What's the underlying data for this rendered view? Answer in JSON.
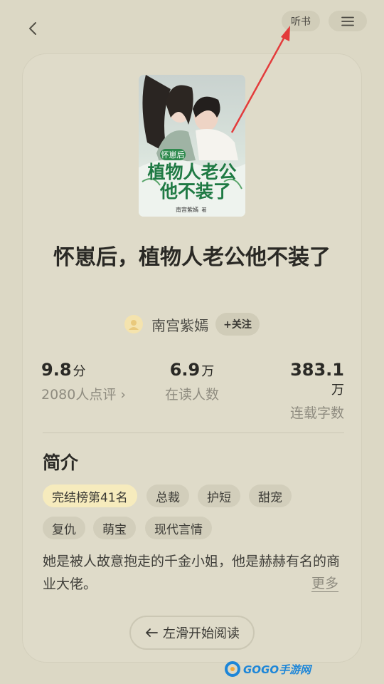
{
  "header": {
    "listen_label": "听书"
  },
  "book": {
    "cover": {
      "series_tag": "怀崽后",
      "title_line1": "植物人老公",
      "title_line2": "他不装了",
      "author_small": "南宫紫嫣",
      "author_suffix": "著"
    },
    "title": "怀崽后，植物人老公他不装了",
    "author": "南宫紫嫣",
    "follow_label": "+关注"
  },
  "stats": [
    {
      "value": "9.8",
      "unit": "分",
      "label": "2080人点评",
      "chevron": "›"
    },
    {
      "value": "6.9",
      "unit": "万",
      "label": "在读人数"
    },
    {
      "value": "383.1",
      "unit": "万",
      "label": "连载字数"
    }
  ],
  "intro": {
    "heading": "简介",
    "tags": [
      "完结榜第41名",
      "总裁",
      "护短",
      "甜宠",
      "复仇",
      "萌宝",
      "现代言情"
    ],
    "description": "她是被人故意抱走的千金小姐，他是赫赫有名的商业大佬。",
    "more_label": "更多"
  },
  "footer": {
    "start_label": "左滑开始阅读"
  },
  "watermark": {
    "text": "GOGO手游网"
  },
  "colors": {
    "background": "#dcd8c5",
    "card": "#dfdbc9",
    "highlight_tag": "#f6ebbd",
    "annotation_arrow": "#e33b3b"
  },
  "icons": {
    "back": "chevron-left-icon",
    "menu": "hamburger-menu-icon",
    "avatar": "user-avatar-icon",
    "start": "arrow-left-icon"
  }
}
